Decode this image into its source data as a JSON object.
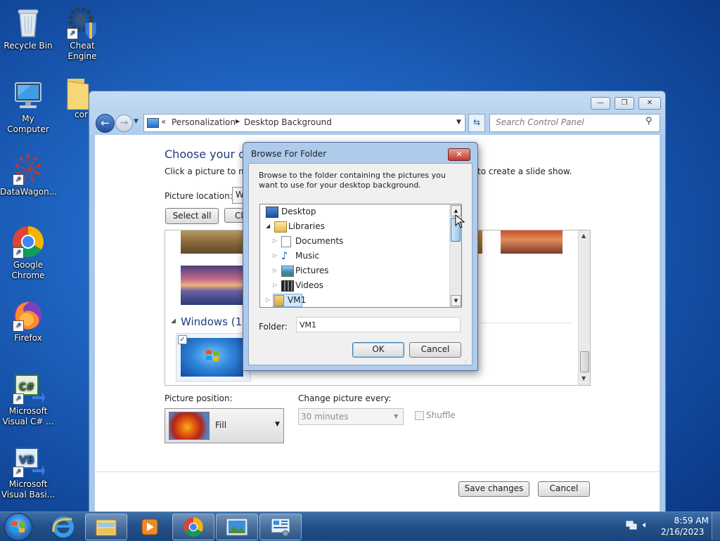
{
  "desktop": {
    "icons": [
      {
        "label": "Recycle Bin"
      },
      {
        "label": "Cheat Engine"
      },
      {
        "label": "My Computer"
      },
      {
        "label": "cor"
      },
      {
        "label": "DataWagon..."
      },
      {
        "label": "Google Chrome"
      },
      {
        "label": "Firefox"
      },
      {
        "label": "Microsoft Visual C# ..."
      },
      {
        "label": "Microsoft Visual Basi..."
      }
    ]
  },
  "control_panel": {
    "breadcrumb_prefix": "«",
    "breadcrumb": [
      "Personalization",
      "Desktop Background"
    ],
    "search_placeholder": "Search Control Panel",
    "heading": "Choose your des",
    "instructions_left": "Click a picture to mak",
    "instructions_right": "to create a slide show.",
    "picture_location_label": "Picture location:",
    "picture_location_value": "W",
    "select_all": "Select all",
    "clear_all": "Cl",
    "group_label": "Windows (1)",
    "picture_position_label": "Picture position:",
    "picture_position_value": "Fill",
    "change_every_label": "Change picture every:",
    "change_every_value": "30 minutes",
    "shuffle_label": "Shuffle",
    "save_changes": "Save changes",
    "cancel": "Cancel"
  },
  "dialog": {
    "title": "Browse For Folder",
    "description": "Browse to the folder containing the pictures you want to use for your desktop background.",
    "tree": [
      {
        "label": "Desktop"
      },
      {
        "label": "Libraries"
      },
      {
        "label": "Documents"
      },
      {
        "label": "Music"
      },
      {
        "label": "Pictures"
      },
      {
        "label": "Videos"
      },
      {
        "label": "VM1"
      }
    ],
    "folder_label": "Folder:",
    "folder_value": "VM1",
    "ok": "OK",
    "cancel": "Cancel"
  },
  "taskbar": {
    "time": "8:59 AM",
    "date": "2/16/2023"
  }
}
